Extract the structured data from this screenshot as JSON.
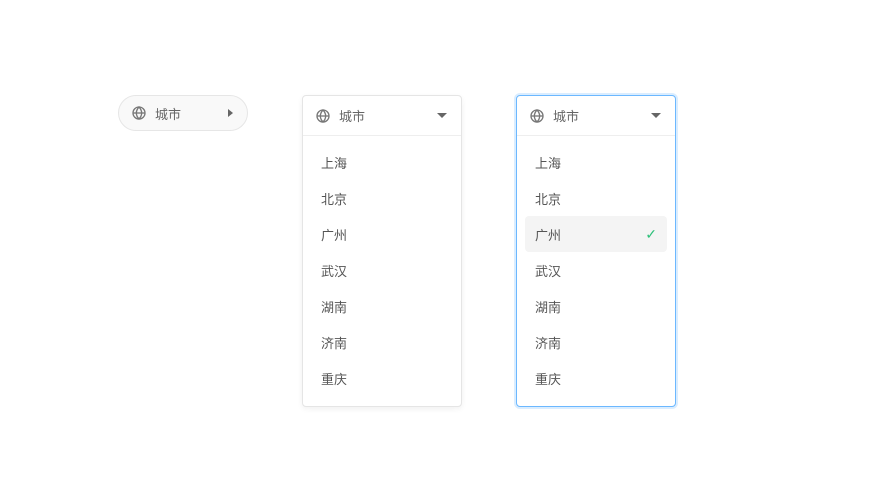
{
  "pill": {
    "label": "城市"
  },
  "menu_open": {
    "header_label": "城市",
    "items": [
      "上海",
      "北京",
      "广州",
      "武汉",
      "湖南",
      "济南",
      "重庆"
    ]
  },
  "menu_focused": {
    "header_label": "城市",
    "items": [
      "上海",
      "北京",
      "广州",
      "武汉",
      "湖南",
      "济南",
      "重庆"
    ],
    "selected_index": 2
  }
}
